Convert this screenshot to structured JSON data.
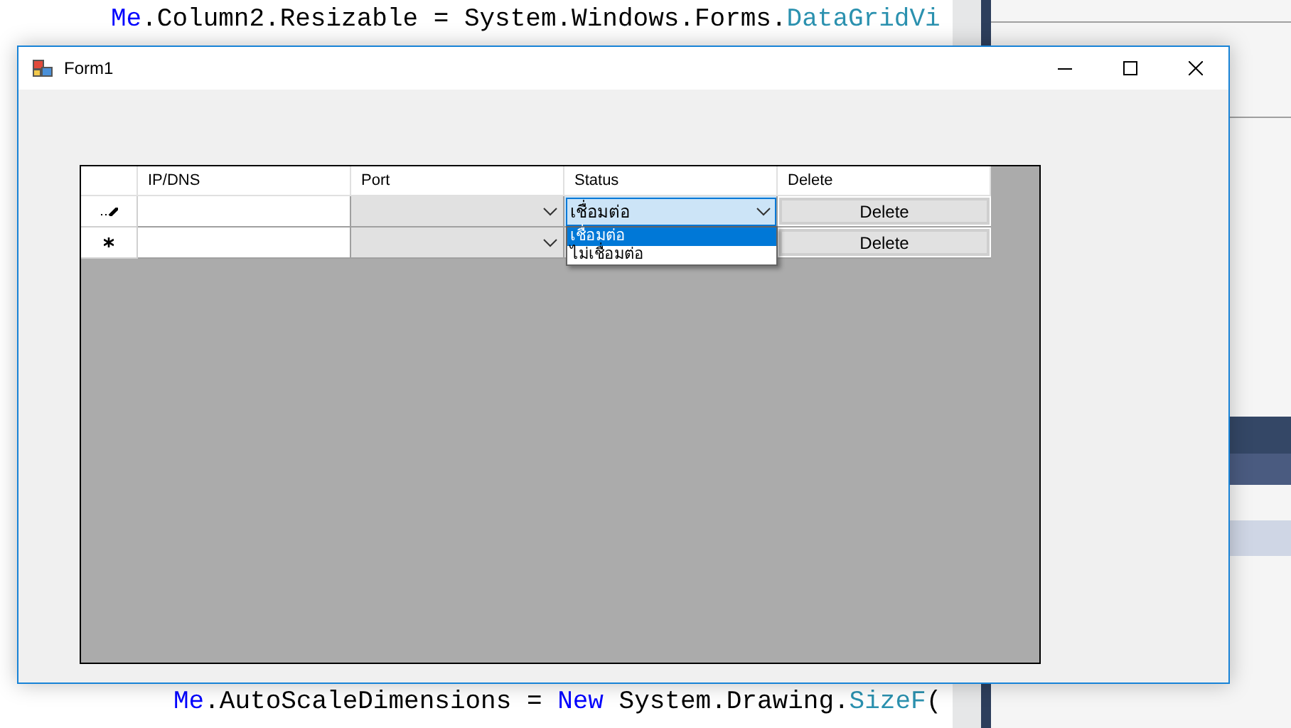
{
  "editor": {
    "top_lines": [
      [
        {
          "text": "Me",
          "kind": "keyword"
        },
        {
          "text": ".Column2.Resizable = System.Windows.Forms.",
          "kind": "plain"
        },
        {
          "text": "DataGridVi",
          "kind": "type"
        }
      ]
    ],
    "bottom_lines": [
      [
        {
          "text": "Me",
          "kind": "keyword"
        },
        {
          "text": ".AutoScaleDimensions = ",
          "kind": "plain"
        },
        {
          "text": "New",
          "kind": "keyword"
        },
        {
          "text": " System.Drawing.",
          "kind": "plain"
        },
        {
          "text": "SizeF",
          "kind": "type"
        },
        {
          "text": "(",
          "kind": "plain"
        }
      ]
    ]
  },
  "window": {
    "title": "Form1"
  },
  "grid": {
    "columns": [
      "IP/DNS",
      "Port",
      "Status",
      "Delete"
    ],
    "rows": [
      {
        "kind": "editing",
        "status": "เชื่อมต่อ",
        "status_focused": true,
        "delete": "Delete"
      },
      {
        "kind": "new",
        "delete": "Delete"
      }
    ],
    "dropdown": {
      "options": [
        {
          "label": "เชื่อมต่อ",
          "selected": true
        },
        {
          "label": "ไม่เชื่อมต่อ",
          "selected": false
        }
      ]
    }
  }
}
